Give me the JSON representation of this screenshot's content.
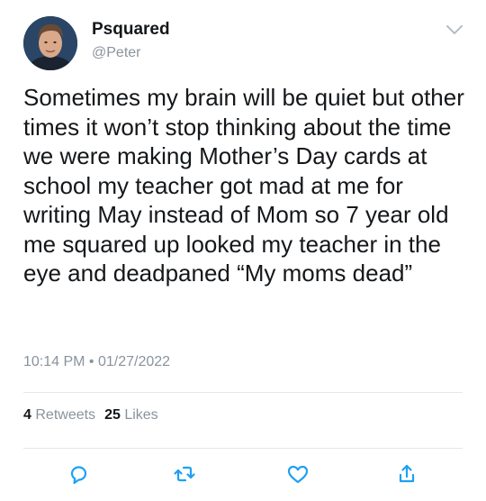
{
  "user": {
    "display_name": "Psquared",
    "handle": "@Peter"
  },
  "tweet": {
    "text": "Sometimes my brain will be quiet but other times it won’t stop thinking about the time we were making Mother’s Day cards at school my teacher got mad at me for writing May instead of Mom so 7 year old me squared up looked my teacher in the eye and deadpaned “My moms dead”",
    "timestamp": "10:14 PM • 01/27/2022"
  },
  "stats": {
    "retweets_count": "4",
    "retweets_label": "Retweets",
    "likes_count": "25",
    "likes_label": "Likes"
  },
  "icons": {
    "menu": "chevron-down-icon",
    "reply": "reply-icon",
    "retweet": "retweet-icon",
    "like": "heart-icon",
    "share": "share-icon"
  },
  "colors": {
    "text": "#14171a",
    "secondary": "#8a939c",
    "action_icon": "#1da1f2",
    "divider": "#e1e8ed"
  }
}
